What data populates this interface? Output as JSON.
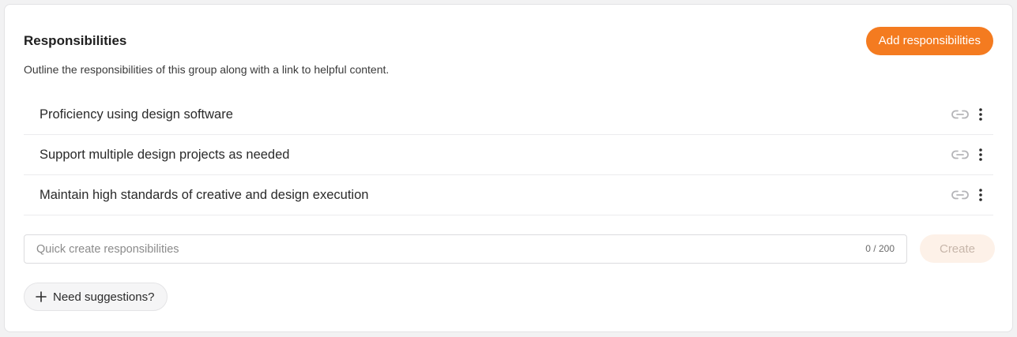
{
  "section": {
    "title": "Responsibilities",
    "subtitle": "Outline the responsibilities of this group along with a link to helpful content.",
    "add_button_label": "Add responsibilities"
  },
  "responsibilities": [
    {
      "label": "Proficiency using design software",
      "link_icon": "link-icon",
      "menu_icon": "more-vertical-icon"
    },
    {
      "label": "Support multiple design projects as needed",
      "link_icon": "link-icon",
      "menu_icon": "more-vertical-icon"
    },
    {
      "label": "Maintain high standards of creative and design execution",
      "link_icon": "link-icon",
      "menu_icon": "more-vertical-icon"
    }
  ],
  "quick_create": {
    "placeholder": "Quick create responsibilities",
    "value": "",
    "counter": "0 / 200",
    "create_label": "Create"
  },
  "suggestions": {
    "label": "Need suggestions?",
    "icon": "plus-icon"
  },
  "colors": {
    "accent": "#f47b20",
    "accent_disabled_bg": "#fdf1e8",
    "accent_disabled_text": "#c7b6aa",
    "icon_muted": "#b5b5b8",
    "icon_dark": "#2b2b2b"
  }
}
